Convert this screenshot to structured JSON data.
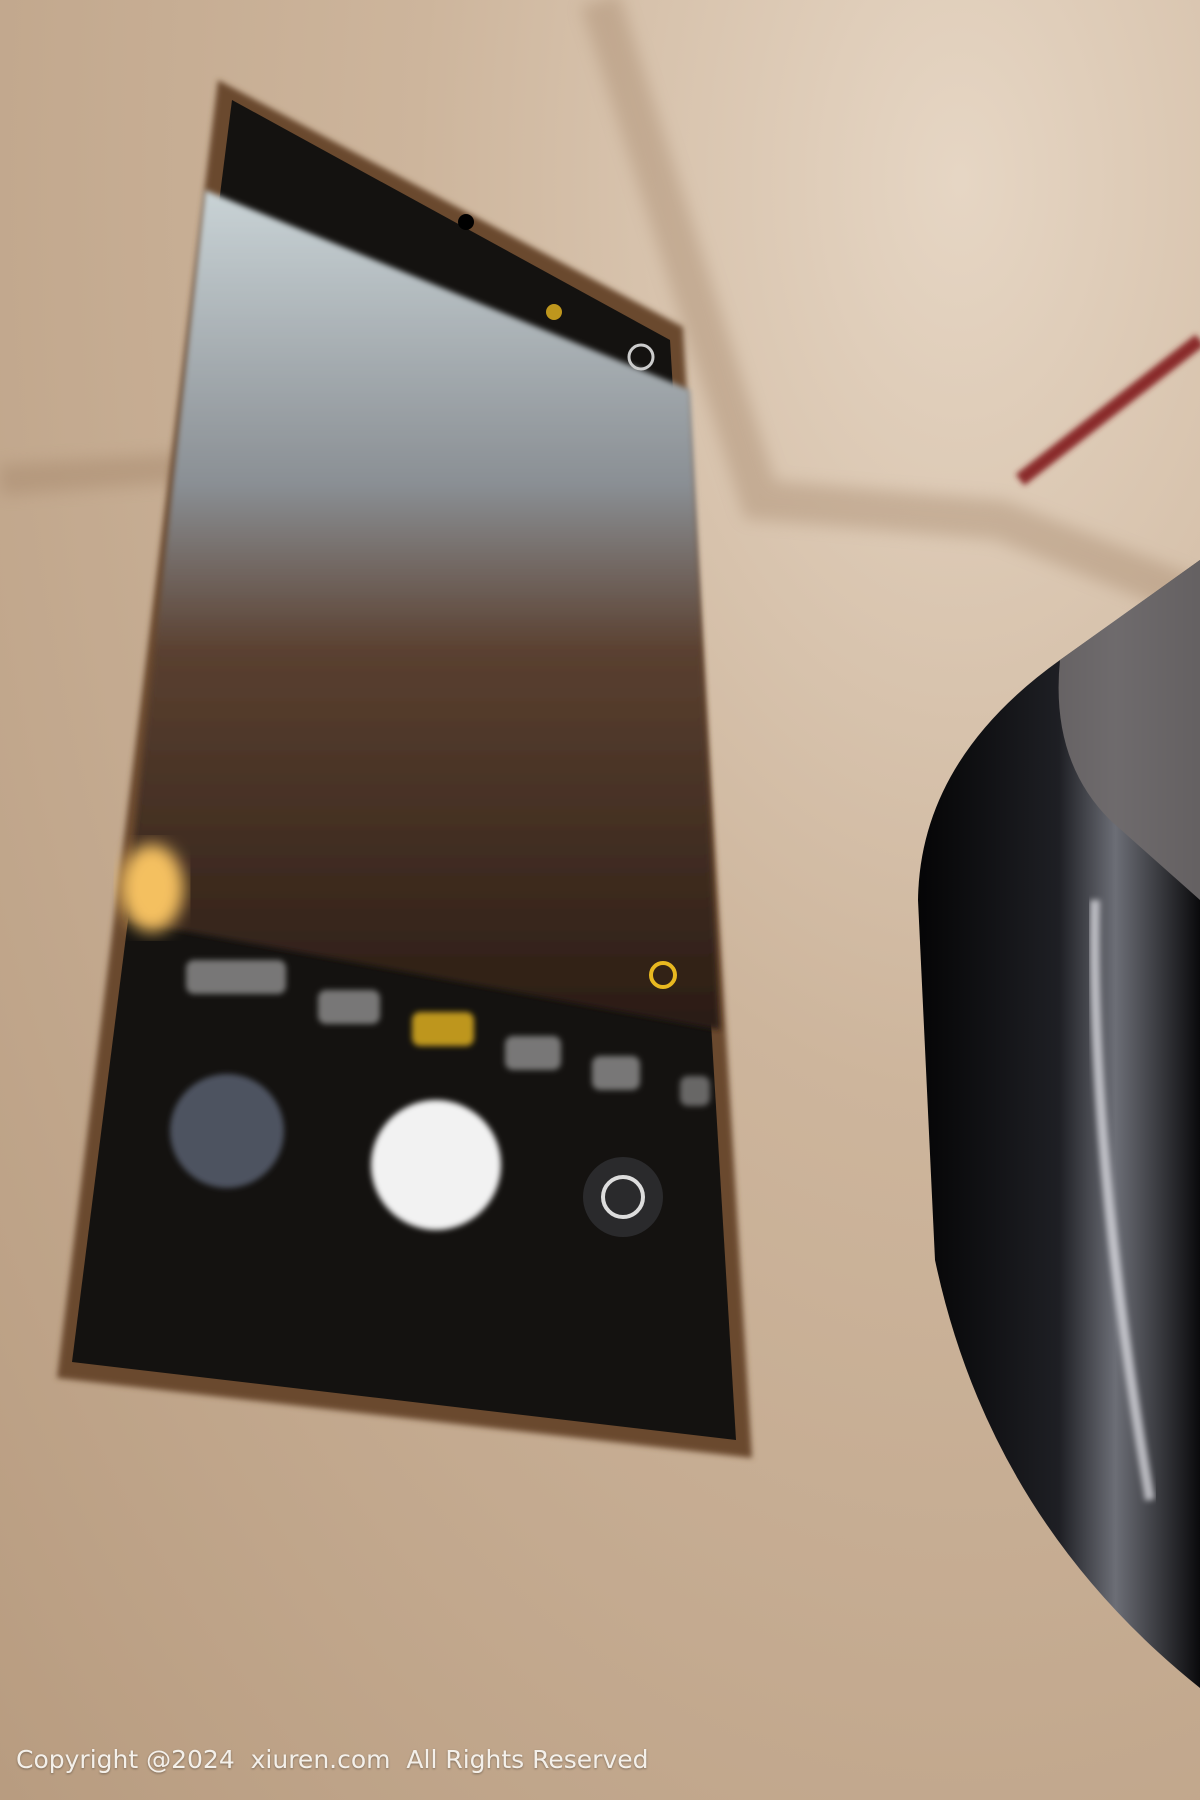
{
  "watermark": {
    "text": "Copyright @2024  xiuren.com  All Rights Reserved"
  },
  "colors": {
    "carpet": "#c9b096",
    "phone_frame": "#6b4a2e",
    "screen": "#141210",
    "shutter": "#f2f2f2",
    "mode_active": "#e8b820",
    "shoe": "#0d0d0f"
  },
  "phone": {
    "camera_ui": {
      "mode_labels_count": 6,
      "active_mode_index": 2,
      "icons": [
        "flash-icon",
        "settings-icon",
        "gallery-thumbnail",
        "shutter-button",
        "switch-camera-icon",
        "filter-icon"
      ]
    }
  }
}
